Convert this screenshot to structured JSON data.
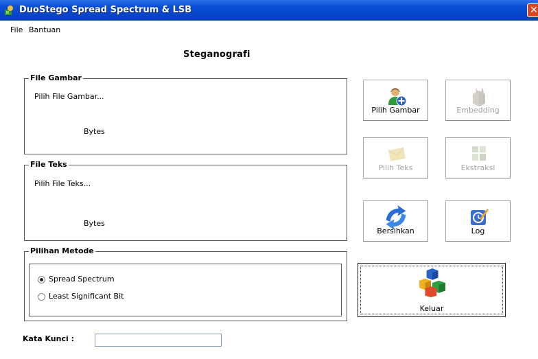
{
  "window": {
    "title": "DuoStego Spread Spectrum & LSB",
    "close_symbol": "✕"
  },
  "menu": {
    "items": [
      "File",
      "Bantuan"
    ]
  },
  "heading": "Steganografi",
  "file_gambar": {
    "title": "File Gambar",
    "file_label": "Pilih File Gambar...",
    "size_label": "Bytes"
  },
  "file_teks": {
    "title": "File Teks",
    "file_label": "Pilih File Teks...",
    "size_label": "Bytes"
  },
  "metode": {
    "title": "Pilihan Metode",
    "options": [
      {
        "label": "Spread Spectrum",
        "checked": true
      },
      {
        "label": "Least Significant Bit",
        "checked": false
      }
    ]
  },
  "buttons": {
    "pilih_gambar": {
      "label": "Pilih Gambar",
      "icon": "add-user-icon",
      "enabled": true
    },
    "embedding": {
      "label": "Embedding",
      "icon": "embed-icon",
      "enabled": false
    },
    "pilih_teks": {
      "label": "Pilih Teks",
      "icon": "envelope-icon",
      "enabled": false
    },
    "ekstraksi": {
      "label": "Ekstraksi",
      "icon": "extract-icon",
      "enabled": false
    },
    "bersihkan": {
      "label": "Bersihkan",
      "icon": "refresh-arrows-icon",
      "enabled": true
    },
    "log": {
      "label": "Log",
      "icon": "log-pencil-icon",
      "enabled": true
    },
    "keluar": {
      "label": "Keluar",
      "icon": "cubes-icon",
      "enabled": true
    }
  },
  "kata_kunci": {
    "label": "Kata Kunci :",
    "value": ""
  },
  "colors": {
    "titlebar": "#0845c9",
    "close": "#d8451f"
  }
}
